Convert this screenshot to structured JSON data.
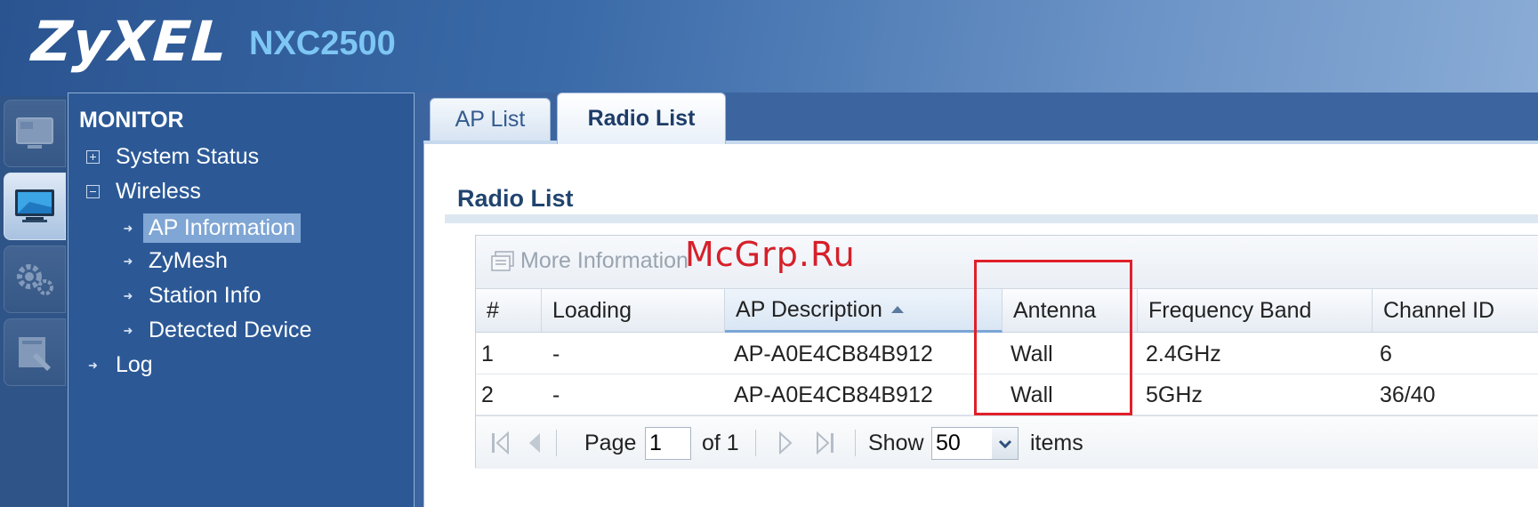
{
  "header": {
    "brand": "ZyXEL",
    "model": "NXC2500"
  },
  "rail": {
    "icons": [
      "dashboard-icon",
      "monitor-icon",
      "configuration-icon",
      "maintenance-icon"
    ],
    "active": "monitor-icon"
  },
  "menu": {
    "title": "MONITOR",
    "items": [
      {
        "label": "System Status",
        "level": 0,
        "expander": "plus"
      },
      {
        "label": "Wireless",
        "level": 0,
        "expander": "minus"
      },
      {
        "label": "AP Information",
        "level": 1,
        "selected": true
      },
      {
        "label": "ZyMesh",
        "level": 1
      },
      {
        "label": "Station Info",
        "level": 1
      },
      {
        "label": "Detected Device",
        "level": 1
      },
      {
        "label": "Log",
        "level": 0
      }
    ]
  },
  "tabs": [
    {
      "label": "AP List",
      "active": false
    },
    {
      "label": "Radio List",
      "active": true
    }
  ],
  "content": {
    "heading": "Radio List",
    "toolbar": {
      "more_info_label": "More Information"
    },
    "table": {
      "columns": [
        "#",
        "Loading",
        "AP Description",
        "Antenna",
        "Frequency Band",
        "Channel ID"
      ],
      "sorted_column": "AP Description",
      "sort_direction": "ascending",
      "rows": [
        [
          "1",
          "-",
          "AP-A0E4CB84B912",
          "Wall",
          "2.4GHz",
          "6"
        ],
        [
          "2",
          "-",
          "AP-A0E4CB84B912",
          "Wall",
          "5GHz",
          "36/40"
        ]
      ]
    },
    "pager": {
      "page_label": "Page",
      "page_value": "1",
      "of_label": "of 1",
      "show_label": "Show",
      "page_size": "50",
      "items_label": "items"
    }
  },
  "watermark": "McGrp.Ru",
  "colors": {
    "header_blue": "#2a5490",
    "menu_blue": "#2c5996",
    "model_cyan": "#7ec6f4",
    "highlight_red": "#e0202a"
  }
}
